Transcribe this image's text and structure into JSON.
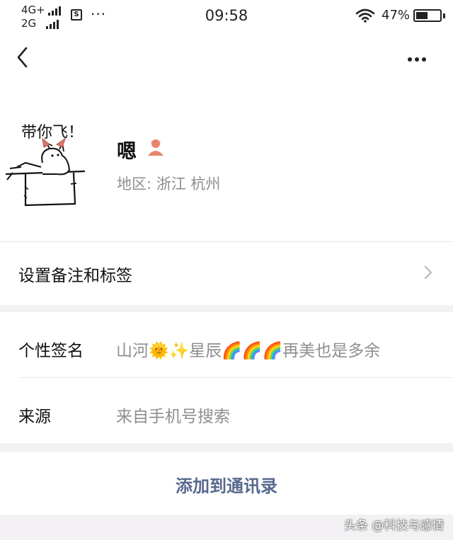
{
  "status_bar": {
    "net_top": "4G+",
    "net_bottom": "2G",
    "sim_label": "S",
    "overflow": "···",
    "time": "09:58",
    "battery_pct": "47%",
    "battery_level": 0.47,
    "icons": [
      "signal-icon",
      "sim-icon",
      "wifi-icon",
      "battery-icon"
    ]
  },
  "nav": {
    "back_icon": "chevron-left-icon",
    "more_icon": "more-dots-icon"
  },
  "profile": {
    "avatar_caption": "带你飞！",
    "name": "嗯",
    "gender_icon": "female-user-icon",
    "region": "地区:  浙江   杭州"
  },
  "remark_row": {
    "label": "设置备注和标签"
  },
  "info": {
    "signature_label": "个性签名",
    "signature_value": "山河🌞✨星辰🌈🌈🌈再美也是多余",
    "source_label": "来源",
    "source_value": "来自手机号搜索"
  },
  "actions": {
    "add_contact": "添加到通讯录"
  },
  "watermark": "头条 @科技与感情",
  "colors": {
    "link": "#57698f",
    "secondary_text": "#8e8e8e",
    "background": "#f3f1f4",
    "gender_female": "#e8836c"
  }
}
